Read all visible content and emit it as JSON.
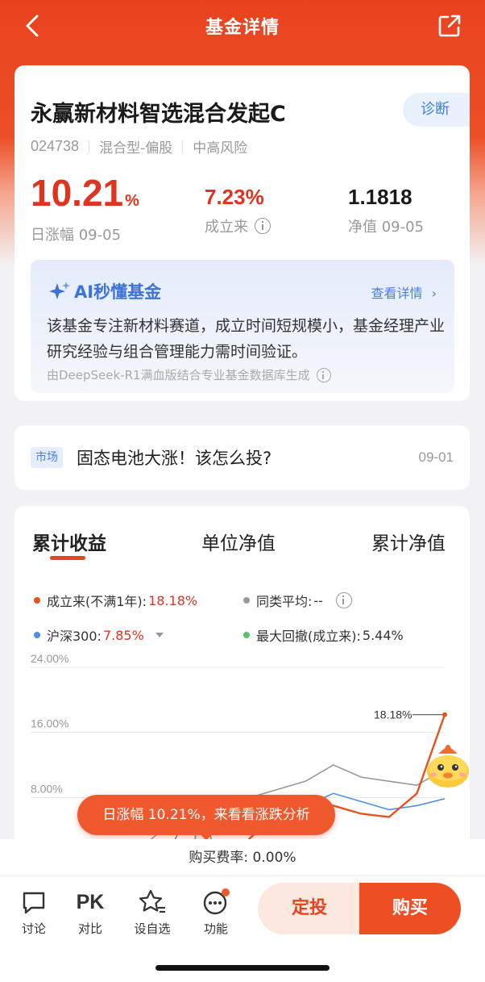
{
  "nav": {
    "title": "基金详情"
  },
  "fund": {
    "name": "永赢新材料智选混合发起C",
    "diagnose_label": "诊断",
    "code": "024738",
    "type": "混合型-偏股",
    "risk": "中高风险",
    "daily_change": "10.21",
    "daily_change_unit": "%",
    "daily_change_label": "日涨幅 09-05",
    "since_inception": "7.23%",
    "since_inception_label": "成立来",
    "nav_value": "1.1818",
    "nav_label": "净值 09-05"
  },
  "ai": {
    "title": "AI秒懂基金",
    "more": "查看详情",
    "text": "该基金专注新材料赛道，成立时间短规模小，基金经理产业研究经验与组合管理能力需时间验证。",
    "source": "由DeepSeek-R1满血版结合专业基金数据库生成"
  },
  "news": {
    "tag": "市场",
    "title": "固态电池大涨！该怎么投?",
    "date": "09-01"
  },
  "chart_tabs": [
    "累计收益",
    "单位净值",
    "累计净值"
  ],
  "legend": {
    "fund_label": "成立来(不满1年):",
    "fund_value": "18.18%",
    "peer_label": "同类平均:",
    "peer_value": "--",
    "index_label": "沪深300:",
    "index_value": "7.85%",
    "drawdown_label": "最大回撤(成立来):",
    "drawdown_value": "5.44%"
  },
  "colors": {
    "fund": "#e8521f",
    "peer": "#999999",
    "index": "#4a8fe8",
    "drawdown": "#5cc06a",
    "accent": "#e8431f"
  },
  "chart_data": {
    "type": "line",
    "y_ticks": [
      "24.00%",
      "16.00%",
      "8.00%"
    ],
    "ylim": [
      0,
      24
    ],
    "end_label": "18.18%",
    "series": [
      {
        "name": "成立来",
        "values": [
          -1,
          0,
          -0.5,
          -2.5,
          2,
          -1.5,
          3,
          6,
          7,
          7,
          6,
          5.6,
          8.5,
          18.18
        ]
      },
      {
        "name": "同类平均",
        "values": [
          -0.5,
          0.5,
          1.5,
          4.5,
          7,
          6,
          8,
          9,
          10,
          12,
          10.5,
          10,
          9.5,
          11.5
        ]
      },
      {
        "name": "沪深300",
        "values": [
          0,
          -0.5,
          0,
          0.5,
          8,
          6,
          5.5,
          6.5,
          7,
          8.5,
          7.5,
          6.5,
          7,
          7.85
        ]
      }
    ]
  },
  "toast": "日涨幅 10.21%，来看看涨跌分析",
  "fee": "购买费率: 0.00%",
  "toolbar": {
    "discuss": "讨论",
    "pk_icon": "PK",
    "compare": "对比",
    "watchlist": "设自选",
    "functions": "功能",
    "dingtou": "定投",
    "buy": "购买"
  }
}
